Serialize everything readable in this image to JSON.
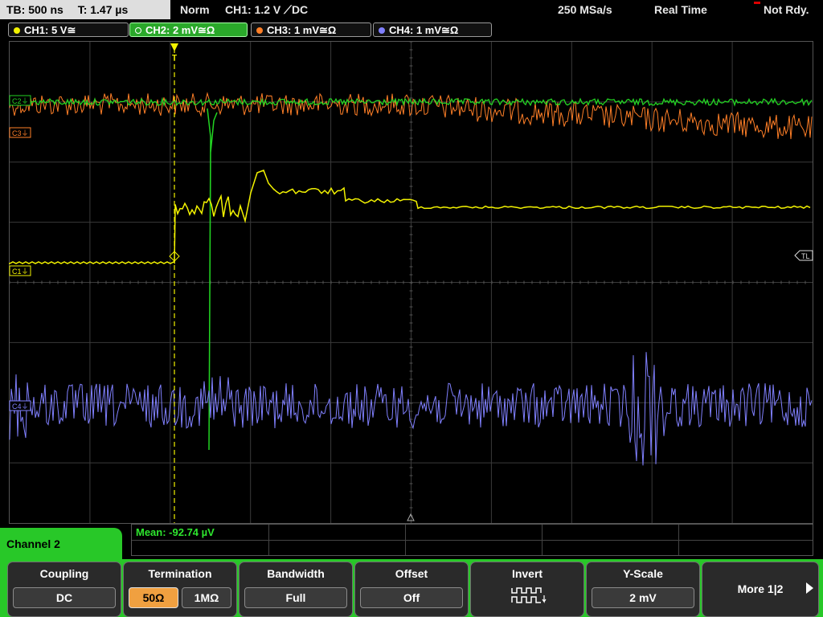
{
  "status": {
    "timebase": "TB: 500 ns",
    "trigger_time": "T: 1.47 µs",
    "mode": "Norm",
    "trigger": "CH1: 1.2 V ⟋DC",
    "sample_rate": "250 MSa/s",
    "acq_mode": "Real Time",
    "ready": "Not Rdy."
  },
  "channels": [
    {
      "label": "CH1: 5 V≅",
      "color": "#f2f200",
      "marker": "C1"
    },
    {
      "label": "CH2: 2 mV≅Ω",
      "color": "#22d422",
      "marker": "C2",
      "active": true
    },
    {
      "label": "CH3: 1 mV≅Ω",
      "color": "#ff7f27",
      "marker": "C3"
    },
    {
      "label": "CH4: 1 mV≅Ω",
      "color": "#8080ff",
      "marker": "C4"
    }
  ],
  "markers": {
    "trigger_level": "TL",
    "trigger_pos": "T"
  },
  "measurement": {
    "text": "Mean: -92.74 µV"
  },
  "panel": {
    "title": "Channel 2"
  },
  "softkeys": {
    "coupling": {
      "label": "Coupling",
      "value": "DC"
    },
    "termination": {
      "label": "Termination",
      "opt1": "50Ω",
      "opt2": "1MΩ",
      "selected": "50Ω"
    },
    "bandwidth": {
      "label": "Bandwidth",
      "value": "Full"
    },
    "offset": {
      "label": "Offset",
      "value": "Off"
    },
    "invert": {
      "label": "Invert",
      "icon": "invert-pulse-icon"
    },
    "yscale": {
      "label": "Y-Scale",
      "value": "2 mV"
    },
    "more": {
      "label": "More 1|2"
    }
  }
}
